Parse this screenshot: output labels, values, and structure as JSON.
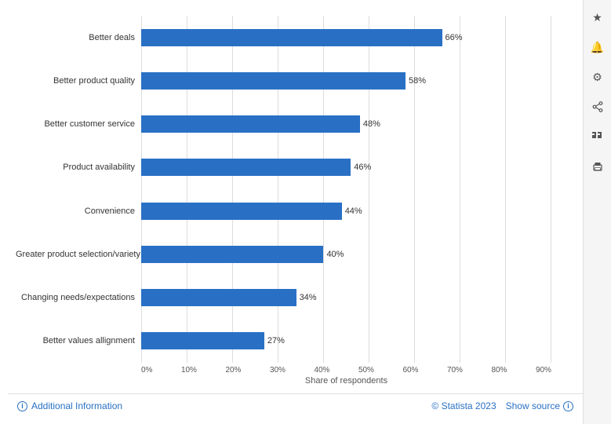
{
  "chart": {
    "bars": [
      {
        "label": "Better deals",
        "value": 66,
        "display": "66%"
      },
      {
        "label": "Better product quality",
        "value": 58,
        "display": "58%"
      },
      {
        "label": "Better customer service",
        "value": 48,
        "display": "48%"
      },
      {
        "label": "Product availability",
        "value": 46,
        "display": "46%"
      },
      {
        "label": "Convenience",
        "value": 44,
        "display": "44%"
      },
      {
        "label": "Greater product selection/variety",
        "value": 40,
        "display": "40%"
      },
      {
        "label": "Changing needs/expectations",
        "value": 34,
        "display": "34%"
      },
      {
        "label": "Better values allignment",
        "value": 27,
        "display": "27%"
      }
    ],
    "x_ticks": [
      "0%",
      "10%",
      "20%",
      "30%",
      "40%",
      "50%",
      "60%",
      "70%",
      "80%",
      "90%"
    ],
    "x_axis_label": "Share of respondents",
    "max_value": 90,
    "bar_color": "#2970c5"
  },
  "footer": {
    "additional_info_label": "Additional Information",
    "credit": "© Statista 2023",
    "show_source_label": "Show source"
  },
  "sidebar": {
    "icons": [
      "★",
      "🔔",
      "⚙",
      "↗",
      "❝",
      "🖨"
    ]
  }
}
